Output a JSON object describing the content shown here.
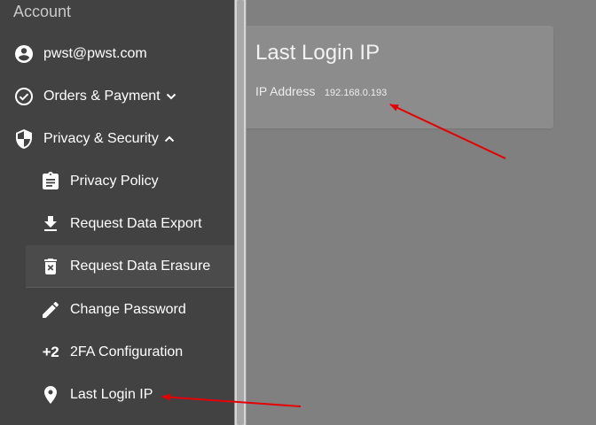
{
  "sidebar": {
    "header": "Account",
    "items": [
      {
        "label": "pwst@pwst.com",
        "icon": "account-circle-icon"
      },
      {
        "label": "Orders & Payment",
        "icon": "check-circle-icon",
        "chevron": "chevron-down-icon"
      },
      {
        "label": "Privacy & Security",
        "icon": "shield-icon",
        "chevron": "chevron-up-icon"
      },
      {
        "label": "Privacy Policy",
        "icon": "clipboard-icon"
      },
      {
        "label": "Request Data Export",
        "icon": "download-icon"
      },
      {
        "label": "Request Data Erasure",
        "icon": "delete-forever-icon",
        "active": true
      },
      {
        "label": "Change Password",
        "icon": "pencil-icon"
      },
      {
        "label": "2FA Configuration",
        "icon": "plus-two-icon",
        "glyph": "+2"
      },
      {
        "label": "Last Login IP",
        "icon": "map-marker-icon"
      }
    ]
  },
  "card": {
    "title": "Last Login IP",
    "ip_label": "IP Address",
    "ip_value": "192.168.0.193"
  },
  "colors": {
    "sidebar_bg": "#424242",
    "main_bg": "#808080",
    "card_bg": "#8c8c8c",
    "annotation": "#e60000"
  }
}
